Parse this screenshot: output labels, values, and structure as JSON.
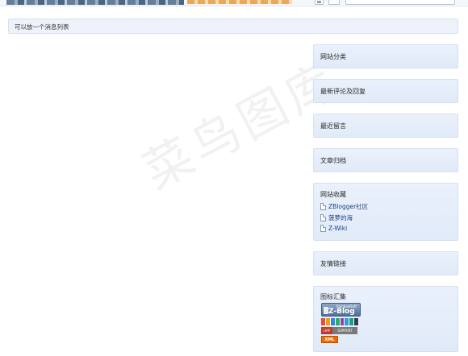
{
  "notice": {
    "text": "可以放一个消息列表"
  },
  "watermark": {
    "text": "菜鸟图库"
  },
  "sidebar": {
    "site_categories": {
      "title": "网站分类"
    },
    "latest_comments": {
      "title": "最新评论及回复"
    },
    "recent_messages": {
      "title": "最近留言"
    },
    "archives": {
      "title": "文章归档"
    },
    "bookmarks": {
      "title": "网站收藏",
      "items": [
        {
          "label": "ZBlogger社区"
        },
        {
          "label": "菠萝的海"
        },
        {
          "label": "Z-Wiki"
        }
      ]
    },
    "friend_links": {
      "title": "友情链接"
    },
    "badges": {
      "title": "图标汇集",
      "zblog_small": "RainbowSoft",
      "zblog_big": "Z-Blog",
      "sup_left": "UAP",
      "sup_right": "SUPPORT",
      "xml": "XML"
    }
  },
  "colors": {
    "panel_bg": "#e1eaf8",
    "link": "#1a3f80",
    "xml_badge": "#f06a00"
  }
}
